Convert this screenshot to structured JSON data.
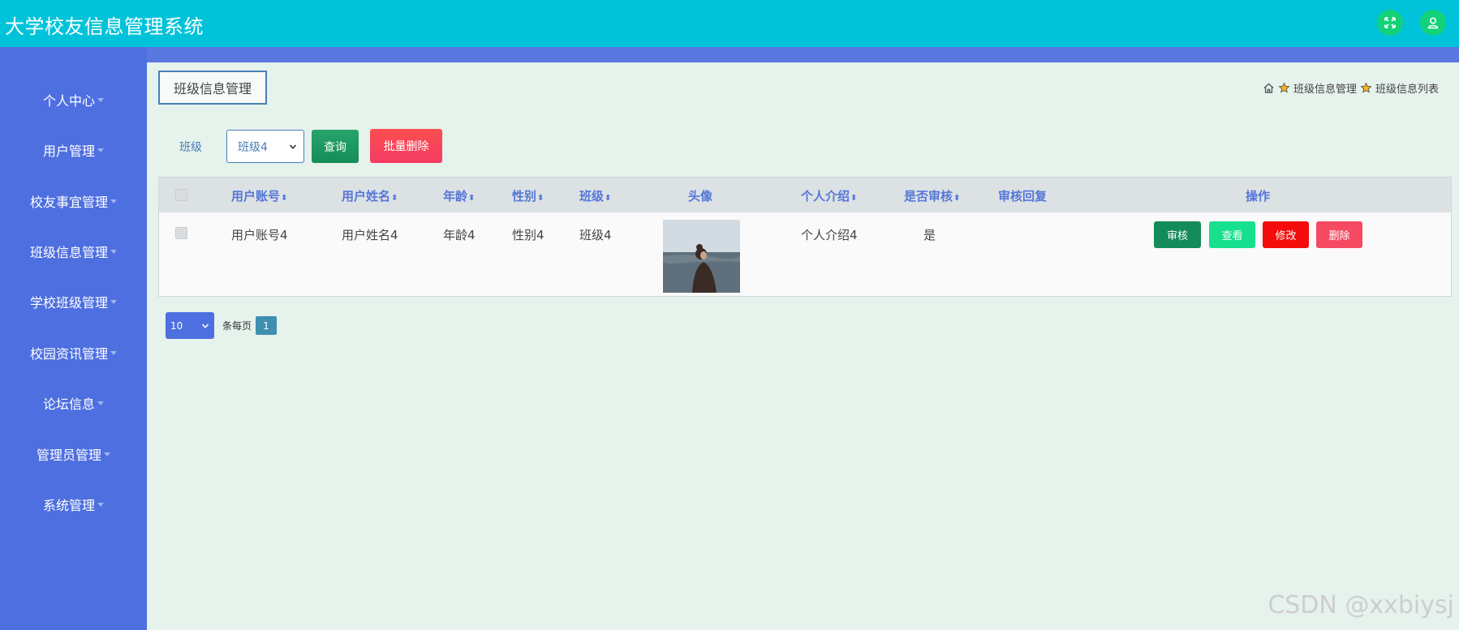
{
  "app": {
    "title": "大学校友信息管理系统"
  },
  "header_icons": [
    "fullscreen-icon",
    "user-icon"
  ],
  "sidebar": {
    "items": [
      {
        "label": "个人中心"
      },
      {
        "label": "用户管理"
      },
      {
        "label": "校友事宜管理"
      },
      {
        "label": "班级信息管理"
      },
      {
        "label": "学校班级管理"
      },
      {
        "label": "校园资讯管理"
      },
      {
        "label": "论坛信息"
      },
      {
        "label": "管理员管理"
      },
      {
        "label": "系统管理"
      }
    ]
  },
  "page": {
    "title_button": "班级信息管理",
    "breadcrumb": [
      "班级信息管理",
      "班级信息列表"
    ]
  },
  "filter": {
    "label": "班级",
    "selected": "班级4",
    "query_label": "查询",
    "batch_delete_label": "批量删除"
  },
  "table": {
    "headers": [
      "用户账号",
      "用户姓名",
      "年龄",
      "性别",
      "班级",
      "头像",
      "个人介绍",
      "是否审核",
      "审核回复",
      "操作"
    ],
    "rows": [
      {
        "account": "用户账号4",
        "name": "用户姓名4",
        "age": "年龄4",
        "gender": "性别4",
        "class": "班级4",
        "intro": "个人介绍4",
        "reviewed": "是",
        "reply": "",
        "actions": [
          "审核",
          "查看",
          "修改",
          "删除"
        ]
      }
    ]
  },
  "pagination": {
    "page_size": "10",
    "per_page_label": "条每页",
    "current_page": "1"
  },
  "watermark": "CSDN @xxbiysj",
  "colors": {
    "topbar": "#00c3d9",
    "sidebar": "#4e6fe0",
    "content_bg": "#e6f2ec",
    "query": "#1f9a61",
    "batch_delete": "#f54651",
    "review": "#138b5b",
    "view": "#16e08e",
    "edit": "#f40c0c",
    "delete": "#f64a63"
  }
}
